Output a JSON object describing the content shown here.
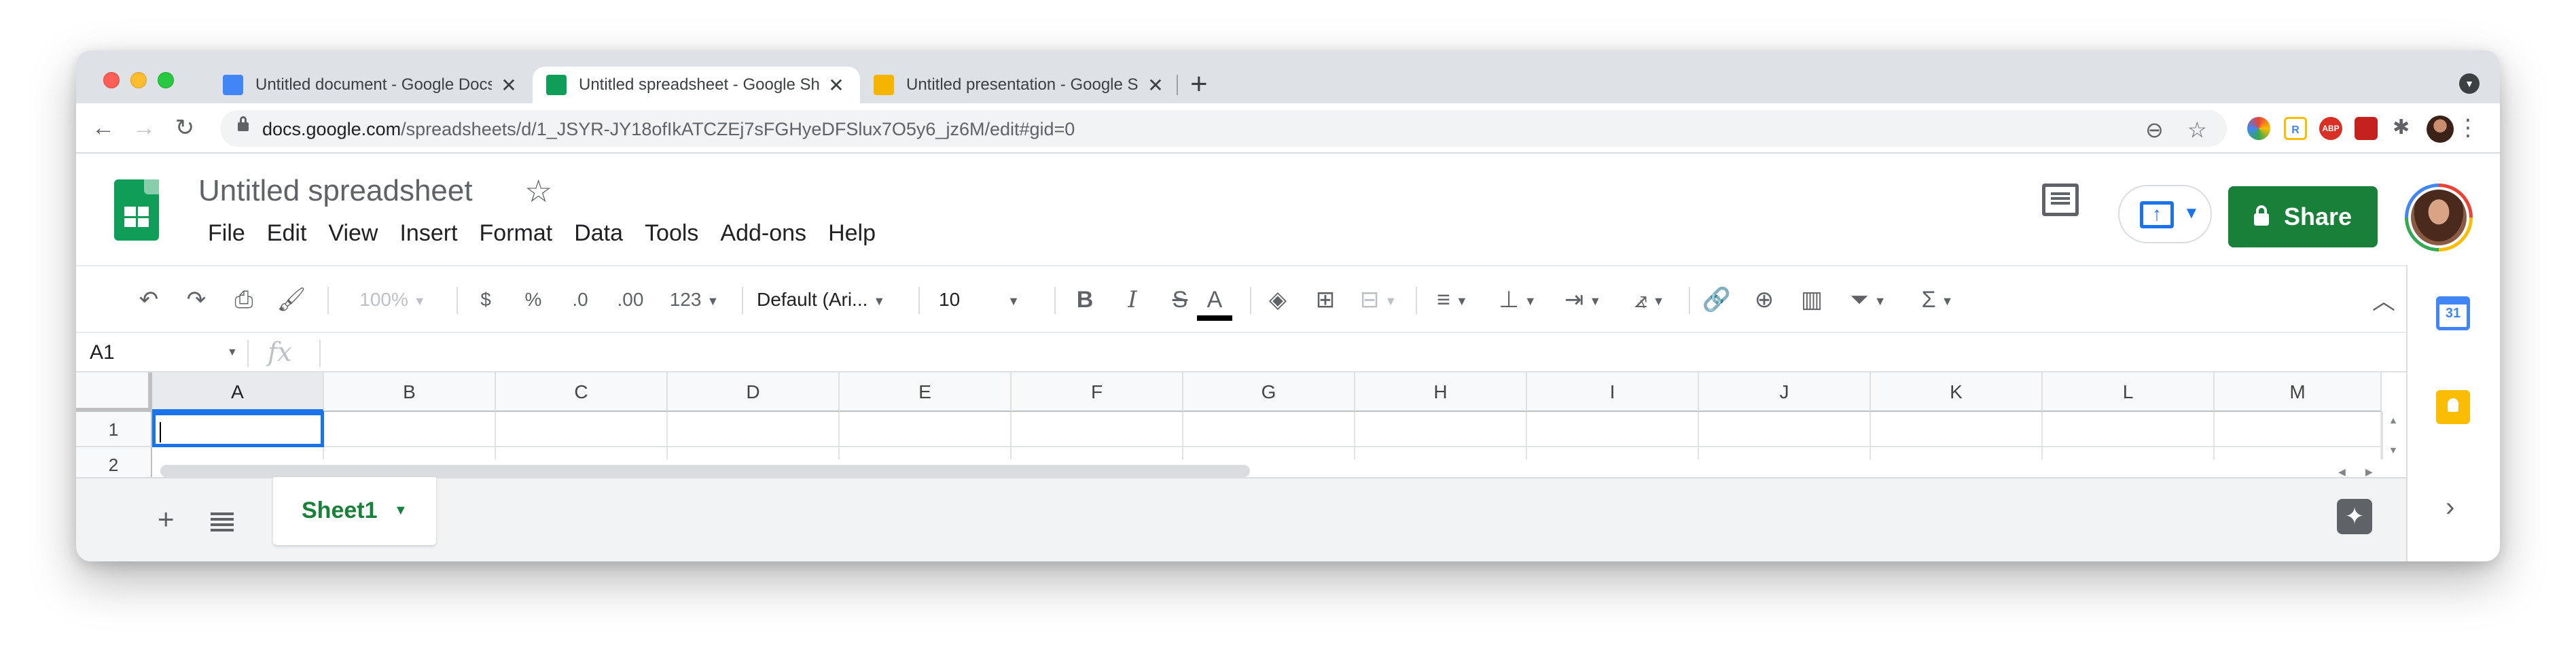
{
  "browser": {
    "tabs": [
      {
        "title": "Untitled document - Google Docs",
        "favicon_color": "#4285f4",
        "icon": "docs-icon"
      },
      {
        "title": "Untitled spreadsheet - Google Sheets",
        "favicon_color": "#0f9d58",
        "icon": "sheets-icon"
      },
      {
        "title": "Untitled presentation - Google Slides",
        "favicon_color": "#f4b400",
        "icon": "slides-icon"
      }
    ],
    "new_tab_label": "+",
    "close_label": "✕",
    "url_host": "docs.google.com",
    "url_path": "/spreadsheets/d/1_JSYR-JY18ofIkATCZEj7sFGHyeDFSlux7O5y6_jz6M/edit#gid=0",
    "extensions": [
      {
        "name": "color-picker-extension-icon",
        "label": ""
      },
      {
        "name": "r-extension-icon",
        "label": "R"
      },
      {
        "name": "adblock-extension-icon",
        "label": "ABP"
      },
      {
        "name": "red-extension-icon",
        "label": ""
      }
    ]
  },
  "app": {
    "title": "Untitled spreadsheet",
    "menu": [
      "File",
      "Edit",
      "View",
      "Insert",
      "Format",
      "Data",
      "Tools",
      "Add-ons",
      "Help"
    ],
    "share_label": "Share",
    "brand_color": "#0f9d58",
    "share_color": "#188038"
  },
  "toolbar": {
    "zoom": "100%",
    "currency": "$",
    "percent": "%",
    "decrease_decimal": ".0",
    "increase_decimal": ".00",
    "more_formats": "123",
    "font": "Default (Ari...",
    "font_size": "10",
    "bold": "B",
    "italic": "I",
    "strikethrough": "S",
    "text_color": "A",
    "functions": "Σ"
  },
  "formula_bar": {
    "name_box": "A1",
    "fx": "fx",
    "formula": ""
  },
  "grid": {
    "columns": [
      "A",
      "B",
      "C",
      "D",
      "E",
      "F",
      "G",
      "H",
      "I",
      "J",
      "K",
      "L",
      "M"
    ],
    "rows": [
      "1",
      "2"
    ],
    "active_cell": "A1"
  },
  "sheets": {
    "tabs": [
      {
        "name": "Sheet1"
      }
    ]
  },
  "side_panel": {
    "calendar_label": "31"
  }
}
